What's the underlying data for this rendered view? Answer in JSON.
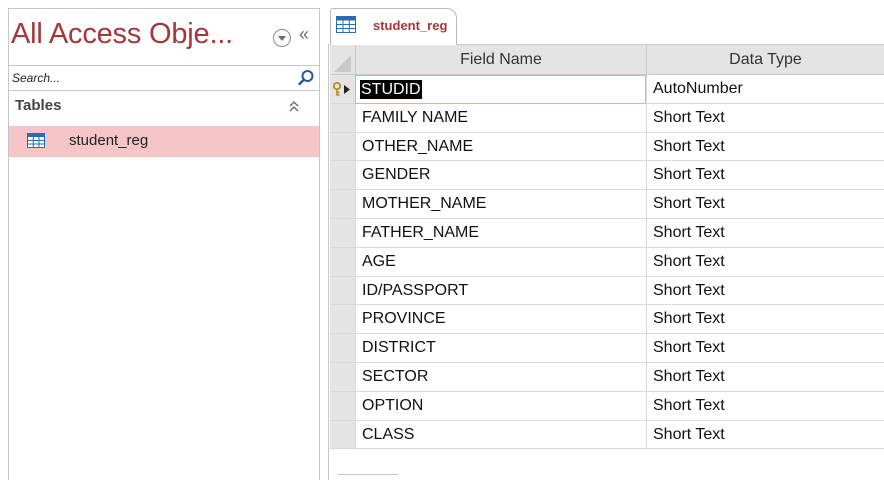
{
  "nav": {
    "title": "All Access Obje...",
    "search_placeholder": "Search...",
    "group_label": "Tables",
    "items": [
      {
        "label": "student_reg",
        "icon": "table-icon"
      }
    ]
  },
  "tab": {
    "label": "student_reg",
    "icon": "table-icon"
  },
  "grid": {
    "columns": [
      "Field Name",
      "Data Type"
    ],
    "rows": [
      {
        "field": "STUDID",
        "type": "AutoNumber",
        "primary_key": true,
        "active": true
      },
      {
        "field": "FAMILY NAME",
        "type": "Short Text"
      },
      {
        "field": "OTHER_NAME",
        "type": "Short Text"
      },
      {
        "field": "GENDER",
        "type": "Short Text"
      },
      {
        "field": "MOTHER_NAME",
        "type": "Short Text"
      },
      {
        "field": "FATHER_NAME",
        "type": "Short Text"
      },
      {
        "field": "AGE",
        "type": "Short Text"
      },
      {
        "field": "ID/PASSPORT",
        "type": "Short Text"
      },
      {
        "field": "PROVINCE",
        "type": "Short Text"
      },
      {
        "field": "DISTRICT",
        "type": "Short Text"
      },
      {
        "field": "SECTOR",
        "type": "Short Text"
      },
      {
        "field": "OPTION",
        "type": "Short Text"
      },
      {
        "field": "CLASS",
        "type": "Short Text"
      }
    ]
  },
  "colors": {
    "accent": "#a4373a",
    "selected_item_bg": "#f5c5c7"
  }
}
